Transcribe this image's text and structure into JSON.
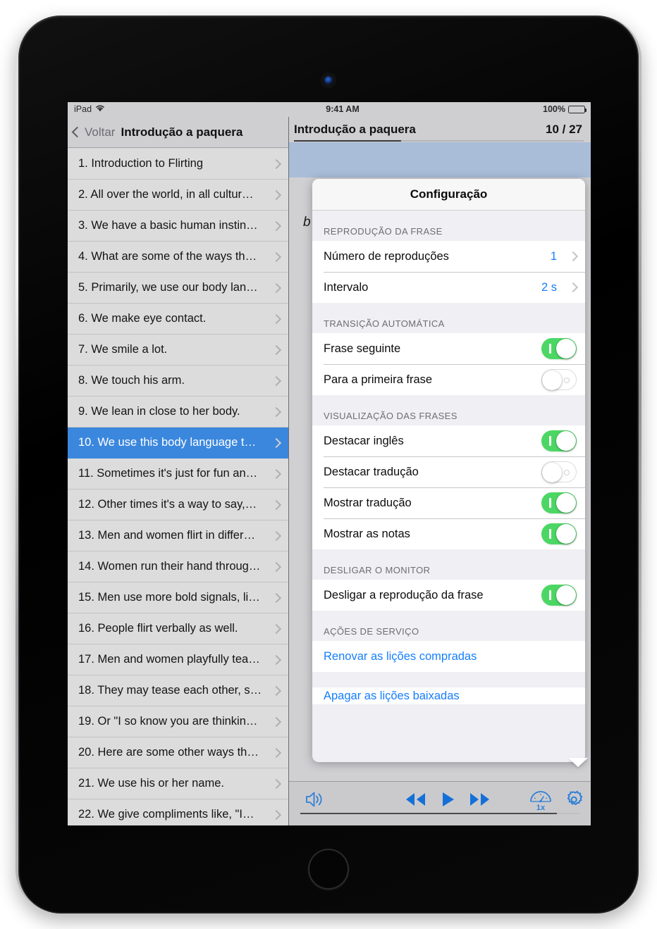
{
  "status_bar": {
    "device": "iPad",
    "wifi_icon": "wifi-icon",
    "time": "9:41 AM",
    "battery_percent": "100%"
  },
  "sidebar": {
    "back_label": "Voltar",
    "title": "Introdução a paquera",
    "selected_index": 9,
    "items": [
      "1. Introduction to Flirting",
      "2. All over the world, in all cultur…",
      "3. We have a basic human instin…",
      "4. What are some of the ways th…",
      "5. Primarily, we use our body lan…",
      "6. We make eye contact.",
      "7. We smile a lot.",
      "8. We touch his arm.",
      "9. We lean in close to her body.",
      "10. We use this body language t…",
      "11. Sometimes it's just for fun an…",
      "12. Other times it's a way to say,…",
      "13. Men and women flirt in differ…",
      "14. Women run their hand throug…",
      "15. Men use more bold signals, li…",
      "16. People flirt verbally as well.",
      "17. Men and women playfully tea…",
      "18. They may tease each other, s…",
      "19. Or \"I so know you are thinkin…",
      "20. Here are some other ways th…",
      "21. We use his or her name.",
      "22. We give compliments like, \"I…"
    ]
  },
  "detail": {
    "title": "Introdução a paquera",
    "counter": "10 / 27",
    "progress_percent": 37,
    "phrase_snippet": "b"
  },
  "toolbar": {
    "volume_icon": "volume-icon",
    "rewind_icon": "rewind-icon",
    "play_icon": "play-icon",
    "forward_icon": "fast-forward-icon",
    "speed_icon": "speed-gauge-icon",
    "speed_label": "1x",
    "settings_icon": "gear-icon",
    "scrubber_percent": 92
  },
  "popover": {
    "title": "Configuração",
    "sections": [
      {
        "header": "REPRODUÇÃO DA FRASE",
        "rows": [
          {
            "label": "Número de reproduções",
            "value": "1",
            "type": "disclosure"
          },
          {
            "label": "Intervalo",
            "value": "2 s",
            "type": "disclosure"
          }
        ]
      },
      {
        "header": "TRANSIÇÃO AUTOMÁTICA",
        "rows": [
          {
            "label": "Frase seguinte",
            "type": "switch",
            "on": true
          },
          {
            "label": "Para a primeira frase",
            "type": "switch",
            "on": false
          }
        ]
      },
      {
        "header": "VISUALIZAÇÃO DAS FRASES",
        "rows": [
          {
            "label": "Destacar inglês",
            "type": "switch",
            "on": true
          },
          {
            "label": "Destacar tradução",
            "type": "switch",
            "on": false
          },
          {
            "label": "Mostrar tradução",
            "type": "switch",
            "on": true
          },
          {
            "label": "Mostrar as notas",
            "type": "switch",
            "on": true
          }
        ]
      },
      {
        "header": "DESLIGAR O MONITOR",
        "rows": [
          {
            "label": "Desligar a reprodução da frase",
            "type": "switch",
            "on": true
          }
        ]
      },
      {
        "header": "AÇÕES DE SERVIÇO",
        "rows": [
          {
            "label": "Renovar as lições compradas",
            "type": "link"
          },
          {
            "label": "Apagar as lições baixadas",
            "type": "link"
          }
        ]
      }
    ]
  },
  "colors": {
    "accent_blue": "#157efb",
    "selection_blue": "#3b87de",
    "switch_green": "#4cd764",
    "highlight_blue": "#a9bdd8"
  }
}
